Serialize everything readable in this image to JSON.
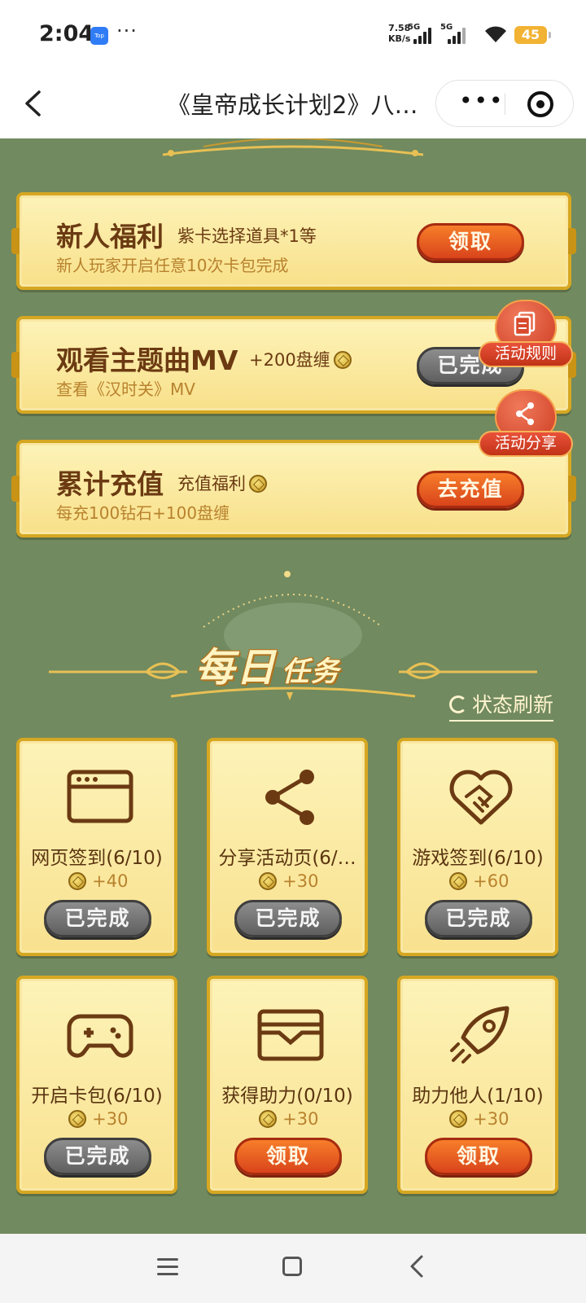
{
  "status_bar": {
    "time": "2:04",
    "app_icon_text": "Top",
    "more_dots": "···",
    "net_speed_value": "7.58",
    "net_speed_unit": "KB/s",
    "sim1": "5G",
    "sim2": "5G",
    "battery": "45"
  },
  "title_bar": {
    "title": "《皇帝成长计划2》八…",
    "more_label": "•••"
  },
  "welfare_tasks": [
    {
      "title": "新人福利",
      "sub": "紫卡选择道具*1等",
      "desc": "新人玩家开启任意10次卡包完成",
      "button": "领取",
      "state": "active"
    },
    {
      "title": "观看主题曲MV",
      "sub": "+200盘缠",
      "desc": "查看《汉时关》MV",
      "button": "已完成",
      "state": "done"
    },
    {
      "title": "累计充值",
      "sub": "充值福利",
      "desc": "每充100钻石+100盘缠",
      "button": "去充值",
      "state": "active"
    }
  ],
  "side_buttons": {
    "rules": "活动规则",
    "share": "活动分享"
  },
  "daily": {
    "title_big": "每日",
    "title_small": "任务",
    "refresh_label": "状态刷新",
    "tasks": [
      {
        "label": "网页签到(6/10)",
        "reward": "+40",
        "button": "已完成",
        "state": "done",
        "icon": "browser-icon"
      },
      {
        "label": "分享活动页(6/…",
        "reward": "+30",
        "button": "已完成",
        "state": "done",
        "icon": "share-icon"
      },
      {
        "label": "游戏签到(6/10)",
        "reward": "+60",
        "button": "已完成",
        "state": "done",
        "icon": "handshake-heart-icon"
      },
      {
        "label": "开启卡包(6/10)",
        "reward": "+30",
        "button": "已完成",
        "state": "done",
        "icon": "gamepad-icon"
      },
      {
        "label": "获得助力(0/10)",
        "reward": "+30",
        "button": "领取",
        "state": "active",
        "icon": "wallet-icon"
      },
      {
        "label": "助力他人(1/10)",
        "reward": "+30",
        "button": "领取",
        "state": "active",
        "icon": "rocket-icon"
      }
    ]
  },
  "colors": {
    "background": "#718a5f",
    "card": "#f8e08a",
    "card_border": "#d6a722",
    "button_active": "#e55a20",
    "button_done": "#6f6f6f",
    "text_brown": "#6b3a12"
  }
}
